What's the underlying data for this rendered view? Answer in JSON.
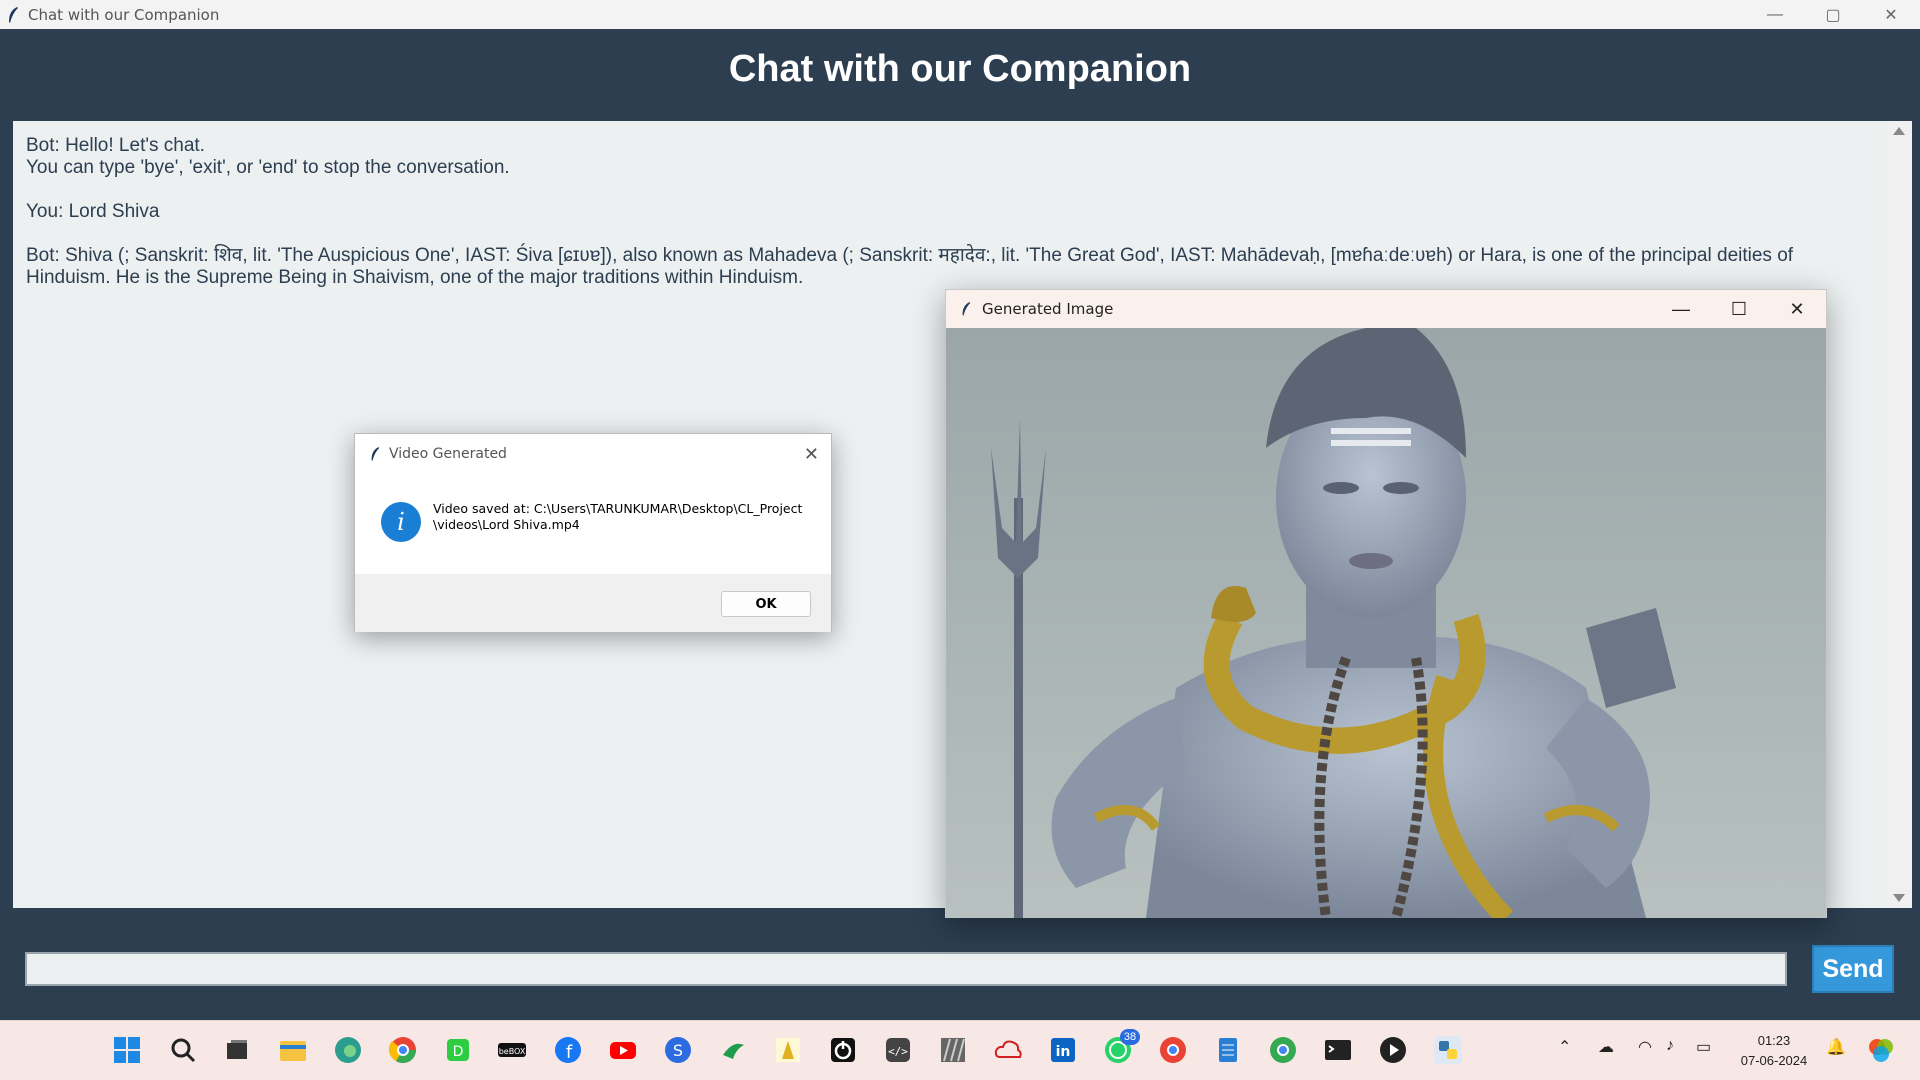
{
  "window": {
    "title": "Chat with our Companion",
    "controls": {
      "minimize": "—",
      "maximize": "▢",
      "close": "✕"
    }
  },
  "header": {
    "title": "Chat with our Companion"
  },
  "chat": {
    "messages": [
      "Bot: Hello! Let's chat.\nYou can type 'bye', 'exit', or 'end' to stop the conversation.",
      "You: Lord Shiva",
      "Bot: Shiva (; Sanskrit: शिव, lit. 'The Auspicious One', IAST: Śiva [ɕɪʋɐ]), also known as Mahadeva (; Sanskrit: महादेव:, lit. 'The Great God', IAST: Mahādevaḥ, [mɐɦaːdeːʋɐh) or Hara, is one of the principal deities of Hinduism. He is the Supreme Being in Shaivism, one of the major traditions within Hinduism."
    ]
  },
  "input": {
    "value": "",
    "send_label": "Send"
  },
  "dialog": {
    "title": "Video Generated",
    "icon": "info-icon",
    "message": "Video saved at: C:\\Users\\TARUNKUMAR\\Desktop\\CL_Project\\videos\\Lord Shiva.mp4",
    "ok_label": "OK"
  },
  "image_window": {
    "title": "Generated Image",
    "controls": {
      "minimize": "—",
      "maximize": "☐",
      "close": "✕"
    }
  },
  "taskbar": {
    "whatsapp_badge": "38",
    "clock": {
      "time": "01:23",
      "date": "07-06-2024"
    }
  },
  "colors": {
    "header_bg": "#2c3e50",
    "chat_bg": "#ecf0f1",
    "send_bg": "#3498db"
  }
}
